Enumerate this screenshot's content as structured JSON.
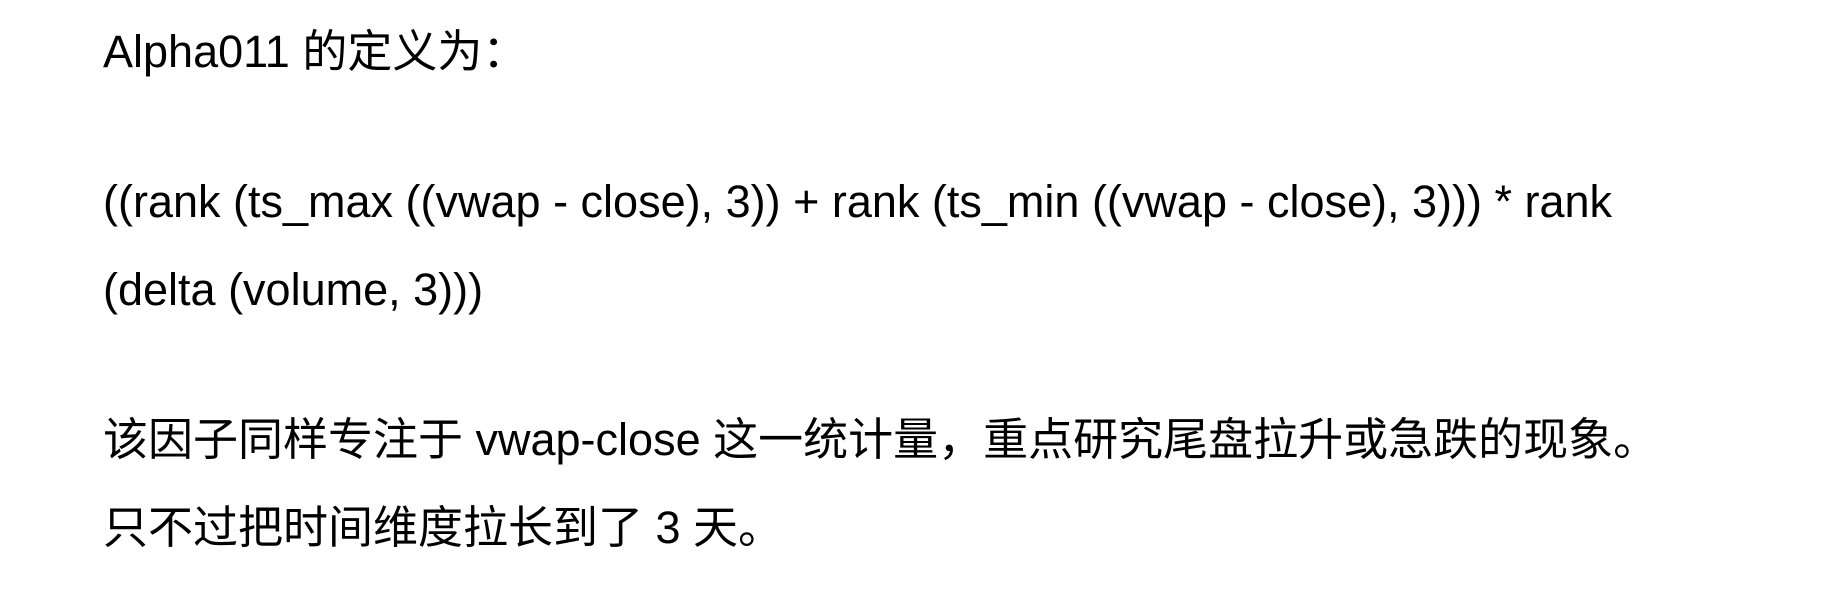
{
  "document": {
    "heading_line": "Alpha011 的定义为：",
    "formula_line_1": "((rank (ts_max ((vwap - close), 3)) + rank (ts_min ((vwap - close), 3))) * rank",
    "formula_line_2": "(delta (volume, 3)))",
    "description_line_1": "该因子同样专注于 vwap-close 这一统计量，重点研究尾盘拉升或急跌的现象。",
    "description_line_2": "只不过把时间维度拉长到了 3 天。"
  }
}
